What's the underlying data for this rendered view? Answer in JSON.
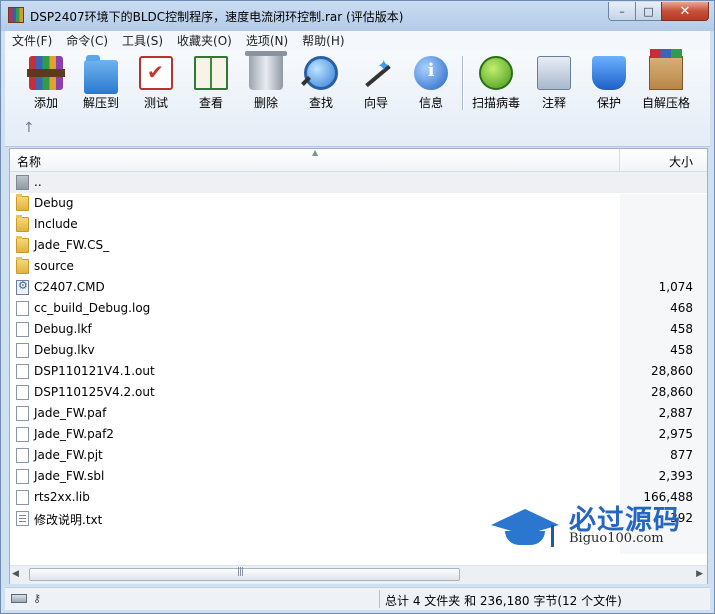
{
  "window": {
    "title": "DSP2407环境下的BLDC控制程序，速度电流闭环控制.rar (评估版本)",
    "buttons": {
      "minimize": "–",
      "maximize": "□",
      "close": "✕"
    }
  },
  "menu": [
    "文件(F)",
    "命令(C)",
    "工具(S)",
    "收藏夹(O)",
    "选项(N)",
    "帮助(H)"
  ],
  "toolbar": {
    "tools": [
      {
        "label": "添加",
        "icon": "books-icon"
      },
      {
        "label": "解压到",
        "icon": "folder-icon"
      },
      {
        "label": "测试",
        "icon": "clipboard-check-icon"
      },
      {
        "label": "查看",
        "icon": "open-book-icon"
      },
      {
        "label": "删除",
        "icon": "trash-icon"
      },
      {
        "label": "查找",
        "icon": "magnifier-icon"
      },
      {
        "label": "向导",
        "icon": "wizard-wand-icon"
      },
      {
        "label": "信息",
        "icon": "info-icon"
      },
      {
        "label": "扫描病毒",
        "icon": "virus-scan-icon"
      },
      {
        "label": "注释",
        "icon": "comment-icon"
      },
      {
        "label": "保护",
        "icon": "shield-icon"
      },
      {
        "label": "自解压格",
        "icon": "sfx-box-icon"
      }
    ],
    "up_arrow": "↑",
    "info_glyph": "i"
  },
  "list": {
    "columns": {
      "name": "名称",
      "size": "大小"
    },
    "sort_indicator": "▲",
    "rows": [
      {
        "name": "..",
        "size": "",
        "type": "up"
      },
      {
        "name": "Debug",
        "size": "",
        "type": "folder"
      },
      {
        "name": "Include",
        "size": "",
        "type": "folder"
      },
      {
        "name": "Jade_FW.CS_",
        "size": "",
        "type": "folder"
      },
      {
        "name": "source",
        "size": "",
        "type": "folder"
      },
      {
        "name": "C2407.CMD",
        "size": "1,074",
        "type": "cmd"
      },
      {
        "name": "cc_build_Debug.log",
        "size": "468",
        "type": "doc"
      },
      {
        "name": "Debug.lkf",
        "size": "458",
        "type": "doc"
      },
      {
        "name": "Debug.lkv",
        "size": "458",
        "type": "doc"
      },
      {
        "name": "DSP110121V4.1.out",
        "size": "28,860",
        "type": "doc"
      },
      {
        "name": "DSP110125V4.2.out",
        "size": "28,860",
        "type": "doc"
      },
      {
        "name": "Jade_FW.paf",
        "size": "2,887",
        "type": "doc"
      },
      {
        "name": "Jade_FW.paf2",
        "size": "2,975",
        "type": "doc"
      },
      {
        "name": "Jade_FW.pjt",
        "size": "877",
        "type": "doc"
      },
      {
        "name": "Jade_FW.sbl",
        "size": "2,393",
        "type": "doc"
      },
      {
        "name": "rts2xx.lib",
        "size": "166,488",
        "type": "doc"
      },
      {
        "name": "修改说明.txt",
        "size": "392",
        "type": "txt"
      }
    ]
  },
  "scrollbar": {
    "left_arrow": "◀",
    "right_arrow": "▶",
    "grip": "|||"
  },
  "status": {
    "summary": "总计 4 文件夹 和 236,180 字节(12 个文件)"
  },
  "watermark": {
    "title": "必过源码",
    "url": "Biguo100.com"
  },
  "colors": {
    "titlebar": "#b9cfea",
    "close_button": "#c8503a",
    "watermark": "#2466c2"
  }
}
